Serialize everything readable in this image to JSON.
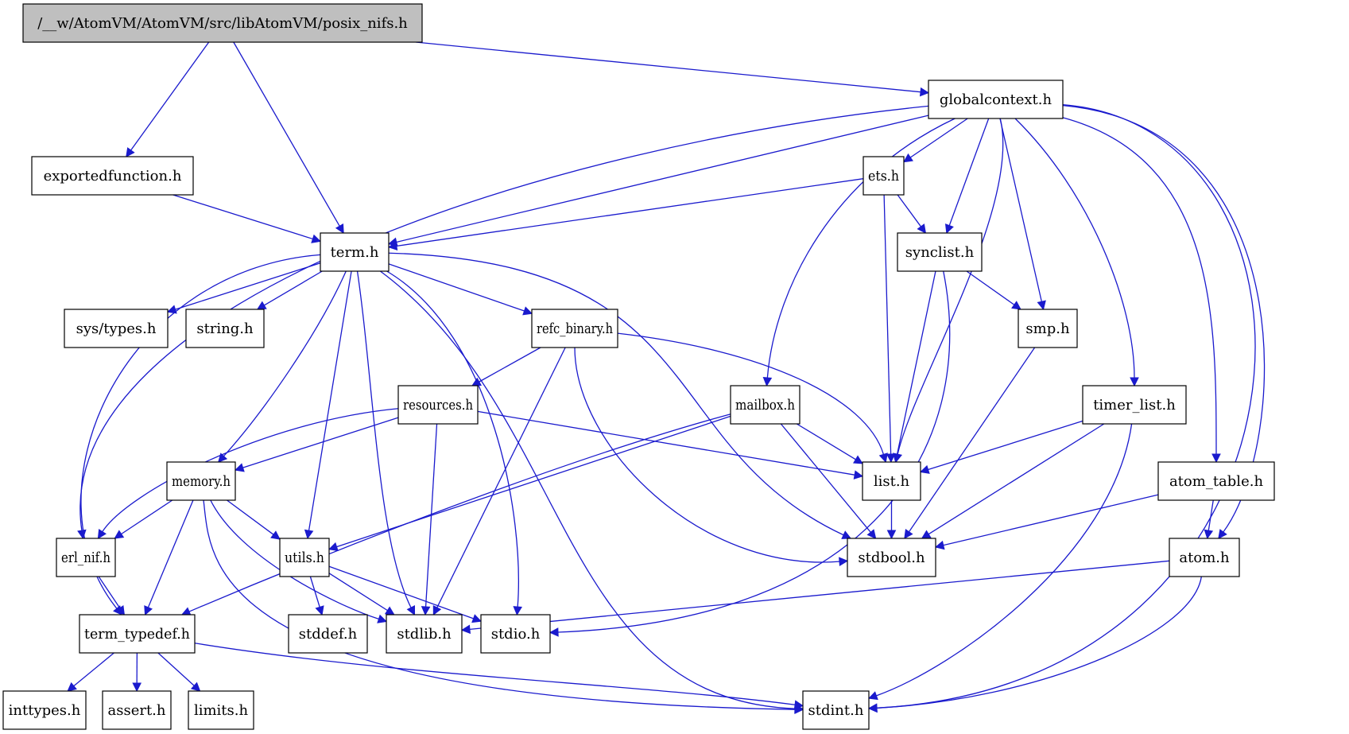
{
  "title": "/__w/AtomVM/AtomVM/src/libAtomVM/posix_nifs.h",
  "colors": {
    "edge": "#1a1acd",
    "root_fill": "#bfbfbf",
    "node_fill": "#ffffff",
    "border": "#000000"
  },
  "nodes": [
    {
      "id": "posix_nifs",
      "label": "/__w/AtomVM/AtomVM/src/libAtomVM/posix_nifs.h",
      "root": true
    },
    {
      "id": "exportedfunction",
      "label": "exportedfunction.h"
    },
    {
      "id": "globalcontext",
      "label": "globalcontext.h"
    },
    {
      "id": "term",
      "label": "term.h"
    },
    {
      "id": "ets",
      "label": "ets.h"
    },
    {
      "id": "synclist",
      "label": "synclist.h"
    },
    {
      "id": "sys_types",
      "label": "sys/types.h"
    },
    {
      "id": "string",
      "label": "string.h"
    },
    {
      "id": "refc_binary",
      "label": "refc_binary.h"
    },
    {
      "id": "smp",
      "label": "smp.h"
    },
    {
      "id": "resources",
      "label": "resources.h"
    },
    {
      "id": "mailbox",
      "label": "mailbox.h"
    },
    {
      "id": "timer_list",
      "label": "timer_list.h"
    },
    {
      "id": "memory",
      "label": "memory.h"
    },
    {
      "id": "list",
      "label": "list.h"
    },
    {
      "id": "atom_table",
      "label": "atom_table.h"
    },
    {
      "id": "erl_nif",
      "label": "erl_nif.h"
    },
    {
      "id": "utils",
      "label": "utils.h"
    },
    {
      "id": "stdbool",
      "label": "stdbool.h"
    },
    {
      "id": "atom",
      "label": "atom.h"
    },
    {
      "id": "term_typedef",
      "label": "term_typedef.h"
    },
    {
      "id": "stddef",
      "label": "stddef.h"
    },
    {
      "id": "stdlib",
      "label": "stdlib.h"
    },
    {
      "id": "stdio",
      "label": "stdio.h"
    },
    {
      "id": "inttypes",
      "label": "inttypes.h"
    },
    {
      "id": "assert",
      "label": "assert.h"
    },
    {
      "id": "limits",
      "label": "limits.h"
    },
    {
      "id": "stdint",
      "label": "stdint.h"
    }
  ],
  "edges": [
    [
      "posix_nifs",
      "exportedfunction"
    ],
    [
      "posix_nifs",
      "term"
    ],
    [
      "posix_nifs",
      "globalcontext"
    ],
    [
      "exportedfunction",
      "term"
    ],
    [
      "globalcontext",
      "erl_nif"
    ],
    [
      "globalcontext",
      "term"
    ],
    [
      "globalcontext",
      "ets"
    ],
    [
      "globalcontext",
      "mailbox"
    ],
    [
      "globalcontext",
      "list"
    ],
    [
      "globalcontext",
      "synclist"
    ],
    [
      "globalcontext",
      "smp"
    ],
    [
      "globalcontext",
      "timer_list"
    ],
    [
      "globalcontext",
      "atom_table"
    ],
    [
      "globalcontext",
      "atom"
    ],
    [
      "globalcontext",
      "stdint"
    ],
    [
      "ets",
      "term"
    ],
    [
      "ets",
      "list"
    ],
    [
      "ets",
      "synclist"
    ],
    [
      "synclist",
      "list"
    ],
    [
      "synclist",
      "smp"
    ],
    [
      "synclist",
      "stdio"
    ],
    [
      "smp",
      "stdbool"
    ],
    [
      "term",
      "term_typedef"
    ],
    [
      "term",
      "sys_types"
    ],
    [
      "term",
      "string"
    ],
    [
      "term",
      "memory"
    ],
    [
      "term",
      "stdlib"
    ],
    [
      "term",
      "utils"
    ],
    [
      "term",
      "stdio"
    ],
    [
      "term",
      "stdint"
    ],
    [
      "term",
      "refc_binary"
    ],
    [
      "term",
      "stdbool"
    ],
    [
      "refc_binary",
      "resources"
    ],
    [
      "refc_binary",
      "stdlib"
    ],
    [
      "refc_binary",
      "stdbool"
    ],
    [
      "refc_binary",
      "list"
    ],
    [
      "resources",
      "erl_nif"
    ],
    [
      "resources",
      "memory"
    ],
    [
      "resources",
      "stdlib"
    ],
    [
      "resources",
      "list"
    ],
    [
      "mailbox",
      "term_typedef"
    ],
    [
      "mailbox",
      "utils"
    ],
    [
      "mailbox",
      "list"
    ],
    [
      "mailbox",
      "stdbool"
    ],
    [
      "memory",
      "erl_nif"
    ],
    [
      "memory",
      "term_typedef"
    ],
    [
      "memory",
      "stdint"
    ],
    [
      "memory",
      "stdlib"
    ],
    [
      "memory",
      "utils"
    ],
    [
      "erl_nif",
      "term_typedef"
    ],
    [
      "utils",
      "stddef"
    ],
    [
      "utils",
      "stdlib"
    ],
    [
      "utils",
      "stdio"
    ],
    [
      "list",
      "stdbool"
    ],
    [
      "timer_list",
      "list"
    ],
    [
      "timer_list",
      "stdbool"
    ],
    [
      "timer_list",
      "stdint"
    ],
    [
      "atom_table",
      "stdbool"
    ],
    [
      "atom_table",
      "atom"
    ],
    [
      "atom",
      "stdlib"
    ],
    [
      "atom",
      "stdint"
    ],
    [
      "term_typedef",
      "inttypes"
    ],
    [
      "term_typedef",
      "assert"
    ],
    [
      "term_typedef",
      "limits"
    ],
    [
      "term_typedef",
      "stdint"
    ]
  ]
}
